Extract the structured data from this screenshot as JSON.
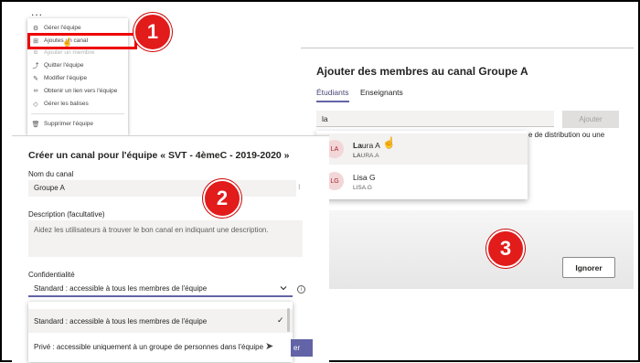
{
  "callouts": [
    "1",
    "2",
    "3"
  ],
  "menu": {
    "more_label": "...",
    "items": [
      {
        "label": "Gérer l'équipe",
        "icon": "gear-icon"
      },
      {
        "label": "Ajoutes un canal",
        "icon": "add-channel-icon"
      },
      {
        "label": "Ajouter un membre",
        "icon": "add-member-icon"
      },
      {
        "label": "Quitter l'équipe",
        "icon": "leave-icon"
      },
      {
        "label": "Modifier l'équipe",
        "icon": "edit-icon"
      },
      {
        "label": "Obtenir un lien vers l'équipe",
        "icon": "link-icon"
      },
      {
        "label": "Gérer les balises",
        "icon": "tag-icon"
      },
      {
        "label": "Supprimer l'équipe",
        "icon": "trash-icon"
      }
    ]
  },
  "create_channel": {
    "title": "Créer un canal pour l'équipe « SVT - 4èmeC - 2019-2020 »",
    "name_label": "Nom du canal",
    "name_value": "Groupe A",
    "description_label": "Description (facultative)",
    "description_placeholder": "Aidez les utilisateurs à trouver le bon canal en indiquant une description.",
    "privacy_label": "Confidentialité",
    "privacy_selected": "Standard : accessible à tous les membres de l'équipe",
    "privacy_options": [
      "Standard : accessible à tous les membres de l'équipe",
      "Privé : accessible uniquement à un groupe de personnes dans l'équipe"
    ],
    "create_button_partial": "er"
  },
  "add_members": {
    "title": "Ajouter des membres au canal Groupe A",
    "tabs": [
      "Étudiants",
      "Enseignants"
    ],
    "search_value": "la",
    "add_button": "Ajouter",
    "hint_text": "e de distribution ou une",
    "suggestions": [
      {
        "initials": "LA",
        "name_bold": "La",
        "name_rest": "ura A",
        "email_bold": "LA",
        "email_rest": "URA.A"
      },
      {
        "initials": "LG",
        "name_bold": "",
        "name_rest": "Lisa G",
        "email_bold": "",
        "email_rest": "LISA.G"
      }
    ],
    "ignore_button": "Ignorer"
  },
  "colors": {
    "callout": "#e21b1b",
    "accent": "#6264a7",
    "avatar_bg": "#f3d6d8",
    "avatar_text": "#a4262c"
  }
}
